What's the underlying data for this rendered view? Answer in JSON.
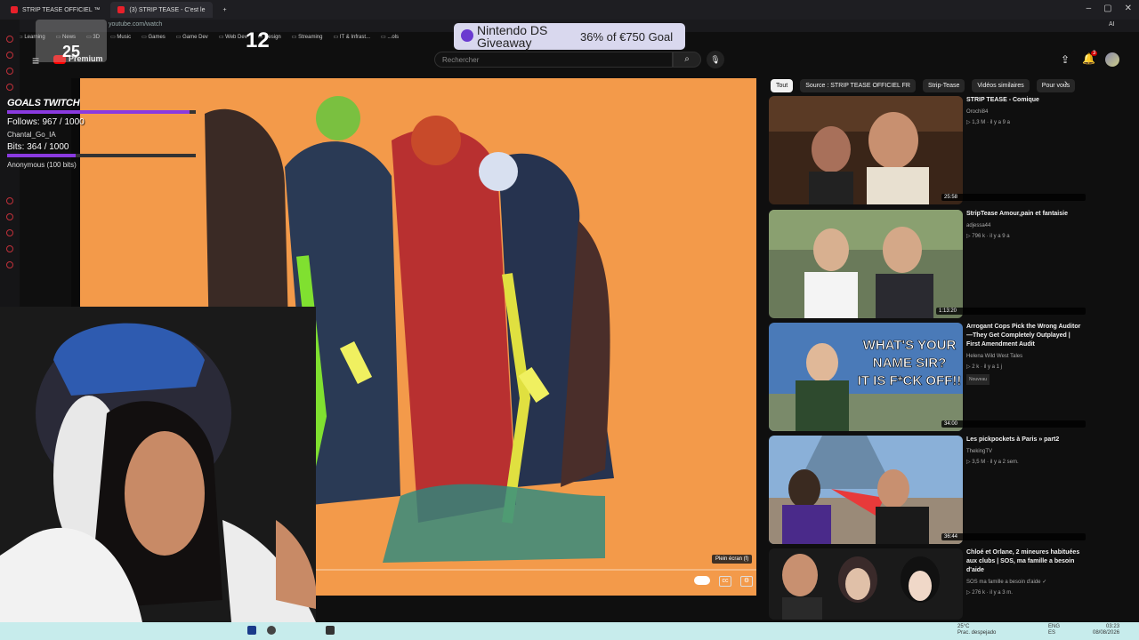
{
  "browser": {
    "tabs": [
      {
        "label": "STRIP TEASE OFFICIEL ™"
      },
      {
        "label": "(3) STRIP TEASE - C'est le"
      }
    ],
    "new_tab": "+",
    "url": "youtube.com/watch",
    "bookmarks": [
      "Learning",
      "News",
      "3D",
      "Music",
      "Games",
      "Game Dev",
      "Web Dev",
      "Design",
      "Streaming",
      "IT & Infrast...",
      "...ols"
    ],
    "ai_label": "AI"
  },
  "youtube": {
    "logo_text": "Premium",
    "search_placeholder": "Rechercher",
    "notifications_count": "3"
  },
  "overlay": {
    "counter_a": "25",
    "counter_b": "12",
    "giveaway_title": "Nintendo DS Giveaway",
    "giveaway_goal": "36% of €750 Goal",
    "goals_title": "GOALS TWITCH",
    "follows": "Follows: 967 / 1000",
    "follows_fraction": 0.967,
    "last_follower": "Chantal_Go_IA",
    "bits": "Bits: 364 / 1000",
    "bits_fraction": 0.364,
    "last_bits": "Anonymous (100 bits)"
  },
  "player": {
    "fullscreen_tooltip": "Plein écran (f)"
  },
  "chips": [
    "Tout",
    "Source : STRIP TEASE OFFICIEL FR",
    "Strip-Tease",
    "Vidéos similaires",
    "Pour vous"
  ],
  "recommendations": [
    {
      "title": "STRIP TEASE - Comique",
      "channel": "Orochi84",
      "meta": "▷ 1,3 M · il y a 9 a",
      "duration": "25:58",
      "badge": ""
    },
    {
      "title": "StripTease Amour,pain et fantaisie",
      "channel": "adjessa44",
      "meta": "▷ 796 k · il y a 9 a",
      "duration": "1:13:20",
      "badge": ""
    },
    {
      "title": "Arrogant Cops Pick the Wrong Auditor—They Get Completely Outplayed | First Amendment Audit",
      "channel": "Helena Wild West Tales",
      "meta": "▷ 2 k · il y a 1 j",
      "duration": "34:00",
      "badge": "Nouveau",
      "thumb_text": "WHAT'S YOUR NAME SIR? IT IS F*CK OFF!!"
    },
    {
      "title": "Les pickpockets à Paris » part2",
      "channel": "ThekingTV",
      "meta": "▷ 3,5 M · il y a 2 sem.",
      "duration": "36:44",
      "badge": ""
    },
    {
      "title": "Chloé et Orlane, 2 mineures habituées aux clubs | SOS, ma famille a besoin d'aide",
      "channel": "SOS ma famille a besoin d'aide ✓",
      "meta": "▷ 276 k · il y a 3 m.",
      "duration": "",
      "badge": ""
    }
  ],
  "taskbar": {
    "weather_temp": "25°C",
    "weather_desc": "Prac. despejado",
    "lang_a": "ENG",
    "lang_b": "ES",
    "time": "03:23",
    "date": "08/08/2026"
  },
  "colors": {
    "accent": "#ff0000",
    "goal_bar": "#8a3ae0",
    "video_bg": "#f39a4a",
    "taskbar": "#c7ecec"
  }
}
